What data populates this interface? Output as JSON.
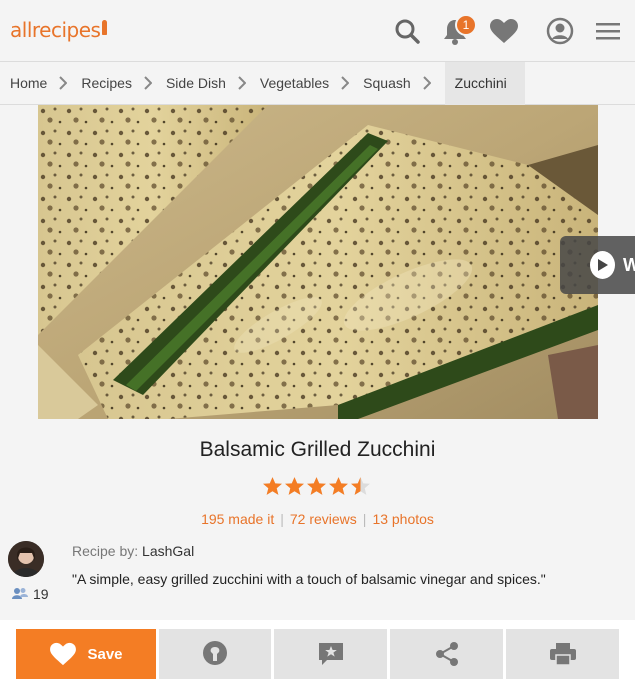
{
  "header": {
    "logo": "allrecipes",
    "notification_count": "1",
    "icons": [
      "search-icon",
      "bell-icon",
      "heart-icon",
      "user-icon",
      "menu-icon"
    ]
  },
  "breadcrumb": [
    "Home",
    "Recipes",
    "Side Dish",
    "Vegetables",
    "Squash",
    "Zucchini"
  ],
  "video": {
    "label": "W"
  },
  "recipe": {
    "title": "Balsamic Grilled Zucchini",
    "rating": 4.5,
    "made_it": "195 made it",
    "reviews": "72 reviews",
    "photos": "13 photos",
    "recipe_by_label": "Recipe by:",
    "author": "LashGal",
    "followers": "19",
    "description": "\"A simple, easy grilled zucchini with a touch of balsamic vinegar and spices.\""
  },
  "actions": {
    "save_label": "Save"
  },
  "colors": {
    "accent": "#f47d24",
    "button_gray": "#e3e3e3"
  }
}
